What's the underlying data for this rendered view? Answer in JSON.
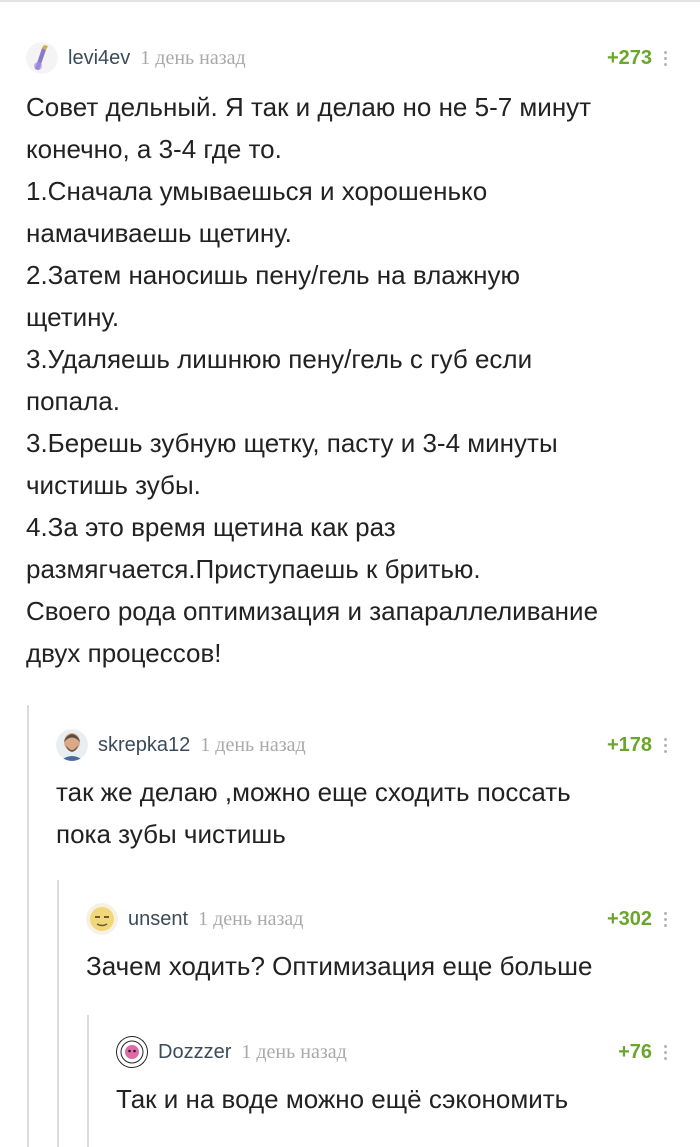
{
  "comments": [
    {
      "author": "levi4ev",
      "time": "1 день назад",
      "rating": "+273",
      "text": "Совет дельный. Я так и делаю но не 5-7 минут\nконечно, а 3-4 где то.\n1.Сначала умываешься и хорошенько\nнамачиваешь щетину.\n2.Затем наносишь пену/гель на влажную\nщетину.\n3.Удаляешь лишнюю пену/гель с губ если\nпопала.\n3.Берешь зубную щетку, пасту и 3-4 минуты\nчистишь зубы.\n4.За это время щетина как раз\nразмягчается.Приступаешь к бритью.\nСвоего рода оптимизация и запараллеливание\nдвух процессов!"
    },
    {
      "author": "skrepka12",
      "time": "1 день назад",
      "rating": "+178",
      "text": "так же делаю ,можно еще сходить поссать\nпока зубы чистишь"
    },
    {
      "author": "unsent",
      "time": "1 день назад",
      "rating": "+302",
      "text": "Зачем ходить? Оптимизация еще больше"
    },
    {
      "author": "Dozzzer",
      "time": "1 день назад",
      "rating": "+76",
      "text": "Так и на воде можно ещё сэкономить"
    }
  ],
  "colors": {
    "author": "#3a4b5a",
    "time": "#a9a9a9",
    "rating": "#6aa62b",
    "thread_line": "#dcdcdc"
  },
  "icons": {
    "more": "more-dots-icon"
  }
}
